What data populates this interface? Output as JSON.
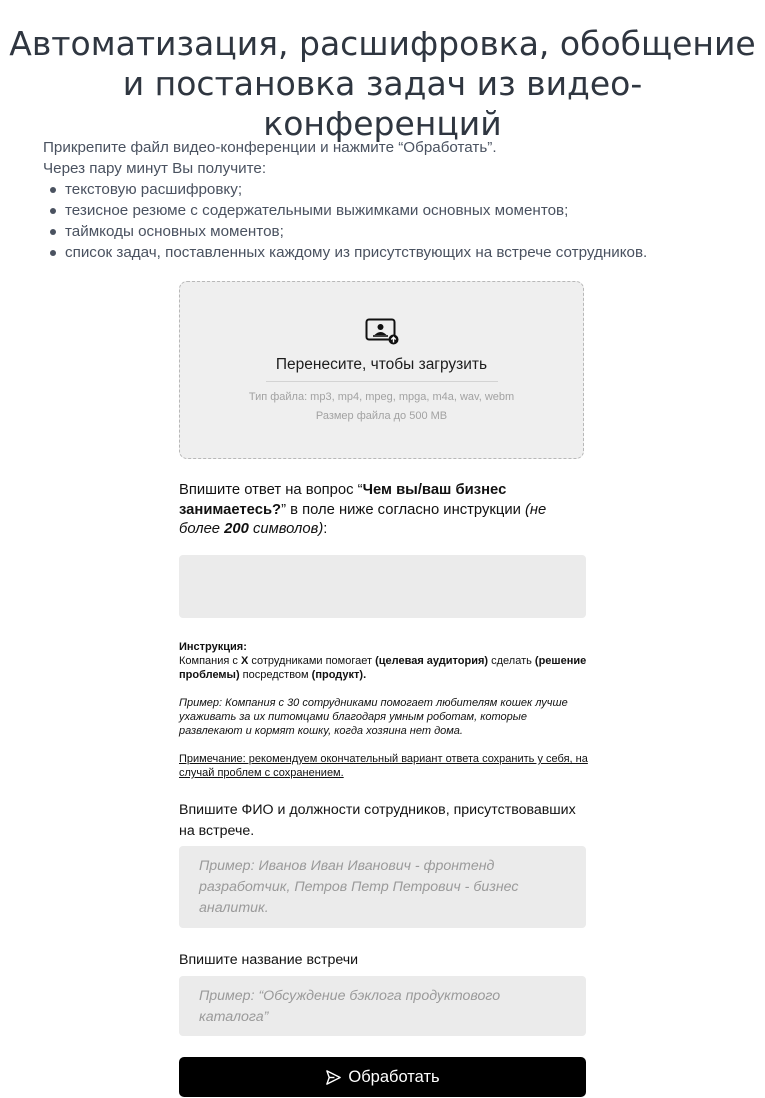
{
  "header": {
    "title_lines": [
      "Автоматизация, расшифровка, обобщение",
      "и постановка задач из видео-",
      "конференций"
    ]
  },
  "intro": {
    "line1": "Прикрепите файл видео-конференции и нажмите “Обработать”.",
    "line2": "Через пару минут Вы получите:",
    "bullets": [
      "текстовую расшифровку;",
      "тезисное резюме с содержательными выжимками основных моментов;",
      "таймкоды основных моментов;",
      "список задач, поставленных каждому из присутствующих на встрече сотрудников."
    ]
  },
  "dropzone": {
    "icon": "video-upload-icon",
    "title": "Перенесите, чтобы загрузить",
    "types": "Тип файла: mp3, mp4, mpeg, mpga, m4a, wav, webm",
    "size": "Размер файла до 500 MB"
  },
  "question": {
    "p1": "Впишите ответ на вопрос “",
    "b1": "Чем вы/ваш бизнес занимаетесь?",
    "p2": "” в поле ниже согласно инструкции ",
    "i1": "(не более ",
    "bi": "200",
    "i2": " символов)",
    "p3": ":",
    "field_value": ""
  },
  "instruction": {
    "heading": "Инструкция:",
    "t1": "Компания с ",
    "b1": "X",
    "t2": " сотрудниками помогает ",
    "b2": "(целевая аудитория)",
    "t3": " сделать ",
    "b3": "(решение проблемы)",
    "t4": " посредством ",
    "b4": "(продукт).",
    "example": "Пример: Компания с 30 сотрудниками помогает любителям кошек лучше ухаживать за их питомцами благодаря умным роботам, которые развлекают и кормят кошку, когда хозяина нет дома.",
    "note": "Примечание: рекомендуем окончательный вариант ответа сохранить у себя, на случай проблем с сохранением."
  },
  "employees": {
    "label": "Впишите ФИО и должности сотрудников, присутствовавших на встрече.",
    "placeholder": "Пример: Иванов Иван Иванович - фронтенд разработчик, Петров Петр Петрович - бизнес аналитик."
  },
  "meeting": {
    "label": "Впишите название встречи",
    "placeholder": "Пример: “Обсуждение бэклога продуктового каталога”"
  },
  "submit": {
    "label": "Обработать",
    "icon": "send-icon",
    "bg": "#000000",
    "fg": "#ffffff"
  }
}
